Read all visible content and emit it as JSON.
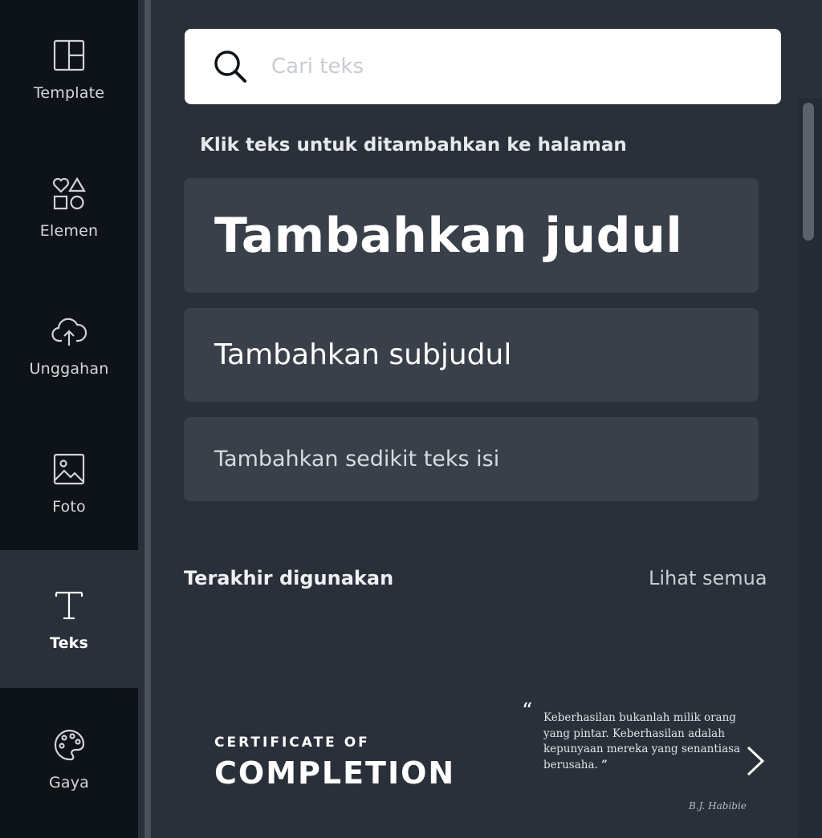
{
  "sidebar": {
    "items": [
      {
        "label": "Template",
        "icon": "template-layout-icon"
      },
      {
        "label": "Elemen",
        "icon": "shapes-icon"
      },
      {
        "label": "Unggahan",
        "icon": "cloud-upload-icon"
      },
      {
        "label": "Foto",
        "icon": "image-icon"
      },
      {
        "label": "Teks",
        "icon": "text-t-icon",
        "active": true
      },
      {
        "label": "Gaya",
        "icon": "palette-icon"
      }
    ]
  },
  "search": {
    "placeholder": "Cari teks"
  },
  "hint": "Klik teks untuk ditambahkan ke halaman",
  "text_options": {
    "heading": "Tambahkan judul",
    "subheading": "Tambahkan subjudul",
    "body": "Tambahkan sedikit teks isi"
  },
  "recent": {
    "title": "Terakhir digunakan",
    "see_all": "Lihat semua",
    "items": [
      {
        "line1": "CERTIFICATE OF",
        "line2": "COMPLETION"
      },
      {
        "open_quote": "“",
        "quote": "Keberhasilan bukanlah milik orang yang pintar. Keberhasilan adalah kepunyaan mereka yang senantiasa berusaha.",
        "close_quote": "”",
        "author": "B.J. Habibie"
      }
    ]
  },
  "colors": {
    "rail": "#0e1318",
    "panel": "#293039",
    "card": "#39404a",
    "search_bg": "#ffffff"
  }
}
